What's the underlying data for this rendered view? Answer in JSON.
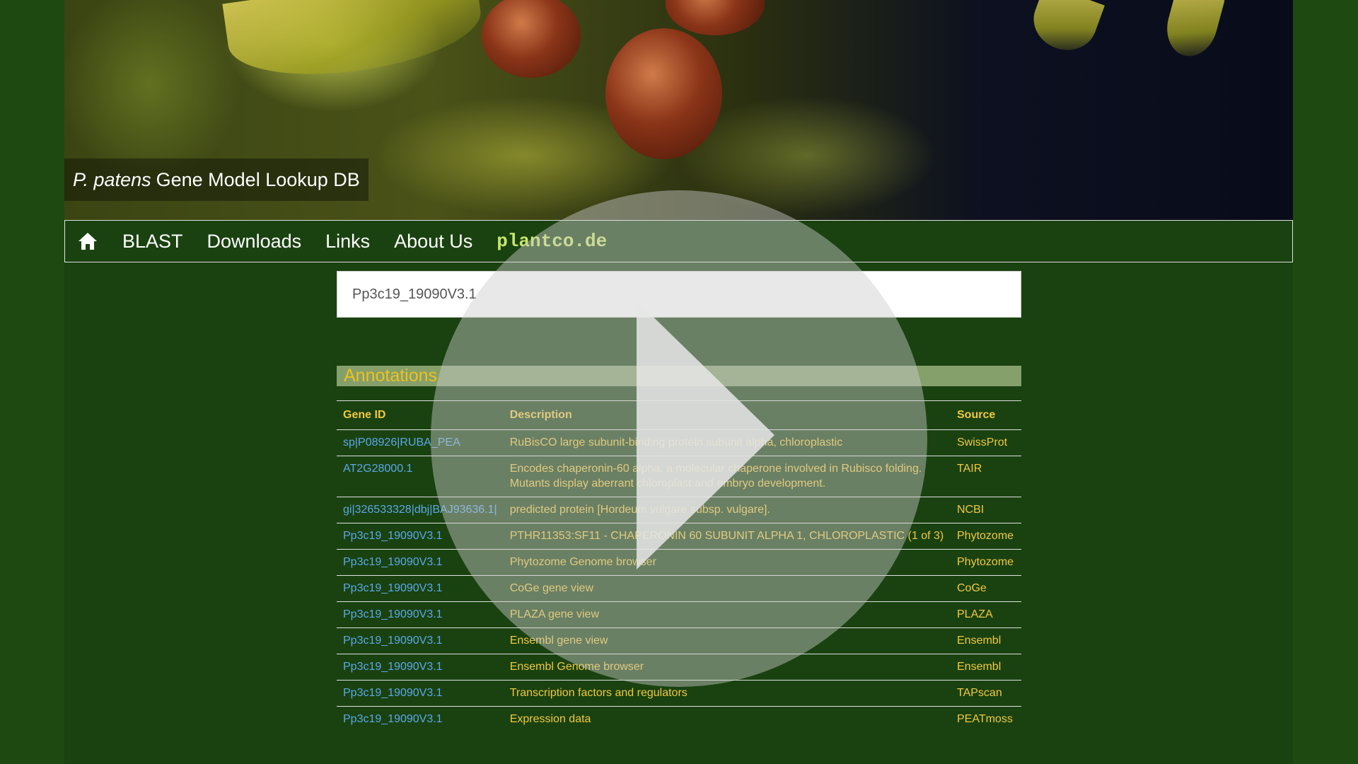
{
  "header": {
    "title_species": "P. patens",
    "title_rest": "Gene Model Lookup DB"
  },
  "nav": {
    "home_icon": "home-icon",
    "items": [
      "BLAST",
      "Downloads",
      "Links",
      "About Us"
    ],
    "brand": "plantco.de"
  },
  "search": {
    "value": "Pp3c19_19090V3.1"
  },
  "annotations": {
    "title": "Annotations",
    "columns": [
      "Gene ID",
      "Description",
      "Source"
    ],
    "rows": [
      {
        "gene_id": "sp|P08926|RUBA_PEA",
        "description": "RuBisCO large subunit-binding protein subunit alpha, chloroplastic",
        "source": "SwissProt"
      },
      {
        "gene_id": "AT2G28000.1",
        "description": "Encodes chaperonin-60 alpha, a molecular chaperone involved in Rubisco folding. Mutants display aberrant chloroplast and embryo development.",
        "source": "TAIR"
      },
      {
        "gene_id": "gi|326533328|dbj|BAJ93636.1|",
        "description": "predicted protein [Hordeum vulgare subsp. vulgare].",
        "source": "NCBI"
      },
      {
        "gene_id": "Pp3c19_19090V3.1",
        "description": "PTHR11353:SF11 - CHAPERONIN 60 SUBUNIT ALPHA 1, CHLOROPLASTIC (1 of 3)",
        "source": "Phytozome"
      },
      {
        "gene_id": "Pp3c19_19090V3.1",
        "description": "Phytozome Genome browser",
        "source": "Phytozome"
      },
      {
        "gene_id": "Pp3c19_19090V3.1",
        "description": "CoGe gene view",
        "source": "CoGe"
      },
      {
        "gene_id": "Pp3c19_19090V3.1",
        "description": "PLAZA gene view",
        "source": "PLAZA"
      },
      {
        "gene_id": "Pp3c19_19090V3.1",
        "description": "Ensembl gene view",
        "source": "Ensembl"
      },
      {
        "gene_id": "Pp3c19_19090V3.1",
        "description": "Ensembl Genome browser",
        "source": "Ensembl"
      },
      {
        "gene_id": "Pp3c19_19090V3.1",
        "description": "Transcription factors and regulators",
        "source": "TAPscan"
      },
      {
        "gene_id": "Pp3c19_19090V3.1",
        "description": "Expression data",
        "source": "PEATmoss"
      }
    ]
  },
  "video_overlay": {
    "icon": "play-icon"
  },
  "colors": {
    "background": "#1a4210",
    "accent": "#f0c840",
    "link": "#5aa8e8"
  }
}
